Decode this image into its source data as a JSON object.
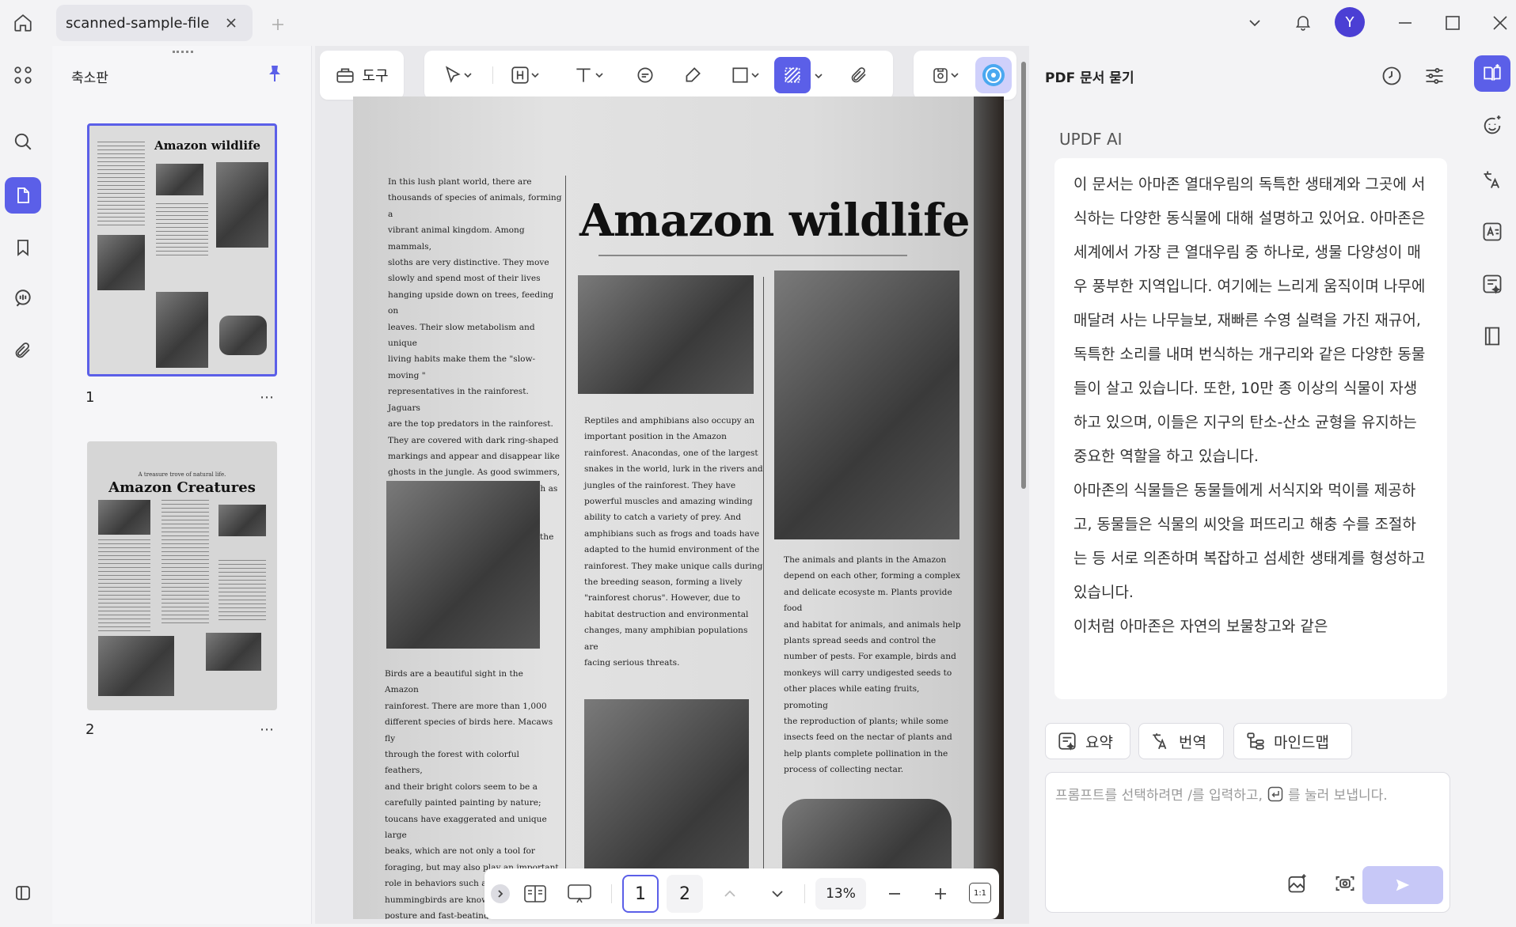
{
  "app": {
    "tab_title": "scanned-sample-file",
    "avatar_letter": "Y"
  },
  "thumbnail_panel": {
    "title": "축소판",
    "pages": [
      {
        "number": "1",
        "title": "Amazon wildlife"
      },
      {
        "number": "2",
        "kicker": "A treasure trove of natural life.",
        "title": "Amazon Creatures"
      }
    ]
  },
  "toolbar": {
    "tools_label": "도구"
  },
  "document": {
    "title": "Amazon wildlife",
    "col1_top": "In this lush plant world, there are\nthousands of species of animals, forming a\nvibrant animal kingdom. Among mammals,\nsloths are very distinctive. They move\nslowly and spend most of their lives\nhanging upside down on trees, feeding on\nleaves. Their slow metabolism and unique\nliving habits make them the \"slow-moving \"\nrepresentatives in the rainforest. Jaguars\nare the top predators in the rainforest.\nThey are covered with dark ring-shaped\nmarkings and appear and disappear like\nghosts in the jungle. As good swimmers,\njaguars can not only chase prey such as\ndeer and monkeys on land, but also catch\nfish, turtles and small crocodiles in the\nwater.",
    "col1_bottom": "Birds are a beautiful sight in the Amazon\nrainforest. There are more than 1,000\ndifferent species of birds here. Macaws fly\nthrough the forest with colorful feathers,\nand their bright colors seem to be a\ncarefully painted painting by nature;\ntoucans have exaggerated and unique large\nbeaks, which are not only a tool for\nforaging, but may also play an important\nrole in behaviors such as courtship;\nhummingbirds are known for their light\nposture and fast-beating wings. They can\nhover in the air to suck nectar, showing\nextraordinary flying skills.",
    "col2": "Reptiles and amphibians also occupy an\nimportant position in the Amazon\nrainforest. Anacondas, one of the largest\nsnakes in the world, lurk in the rivers and\njungles of the rainforest. They have\npowerful muscles and amazing winding\nability to catch a variety of prey. And\namphibians such as frogs and toads have\nadapted to the humid environment of the\nrainforest. They make unique calls during\nthe breeding season, forming a lively\n\"rainforest chorus\". However, due to\nhabitat destruction and environmental\nchanges, many amphibian populations are\nfacing serious threats.",
    "col3": "The animals and plants in the Amazon\ndepend on each other, forming a complex\nand delicate ecosyste m. Plants provide food\nand habitat for animals, and animals help\nplants spread seeds and control the\nnumber of pests. For example, birds and\nmonkeys will carry undigested seeds to\nother places while eating fruits, promoting\nthe reproduction of plants; while some\ninsects feed on the nectar of plants and\nhelp plants complete pollination in the\nprocess of collecting nectar."
  },
  "bottom_nav": {
    "page_current": "1",
    "page_next": "2",
    "zoom": "13%",
    "fit_label": "1:1"
  },
  "ai_panel": {
    "header_title": "PDF 문서 묻기",
    "sender": "UPDF AI",
    "message": "이 문서는 아마존 열대우림의 독특한 생태계와 그곳에 서식하는 다양한 동식물에 대해 설명하고 있어요. 아마존은 세계에서 가장 큰 열대우림 중 하나로, 생물 다양성이 매우 풍부한 지역입니다. 여기에는 느리게 움직이며 나무에 매달려 사는 나무늘보, 재빠른 수영 실력을 가진 재규어, 독특한 소리를 내며 번식하는 개구리와 같은 다양한 동물들이 살고 있습니다. 또한, 10만 종 이상의 식물이 자생하고 있으며, 이들은 지구의 탄소-산소 균형을 유지하는 중요한 역할을 하고 있습니다.",
    "message_2": "아마존의 식물들은 동물들에게 서식지와 먹이를 제공하고, 동물들은 식물의 씨앗을 퍼뜨리고 해충 수를 조절하는 등 서로 의존하며 복잡하고 섬세한 생태계를 형성하고 있습니다.",
    "message_3": "이처럼 아마존은 자연의 보물창고와 같은",
    "chips": [
      "요약",
      "번역",
      "마인드맵"
    ],
    "prompt_placeholder_before": "프롬프트를 선택하려면 /를 입력하고,",
    "prompt_placeholder_after": "를 눌러 보냅니다."
  },
  "colors": {
    "accent": "#5b5fe8",
    "accent_light": "#cfd0fb",
    "send_disabled": "#c7c8f7"
  }
}
